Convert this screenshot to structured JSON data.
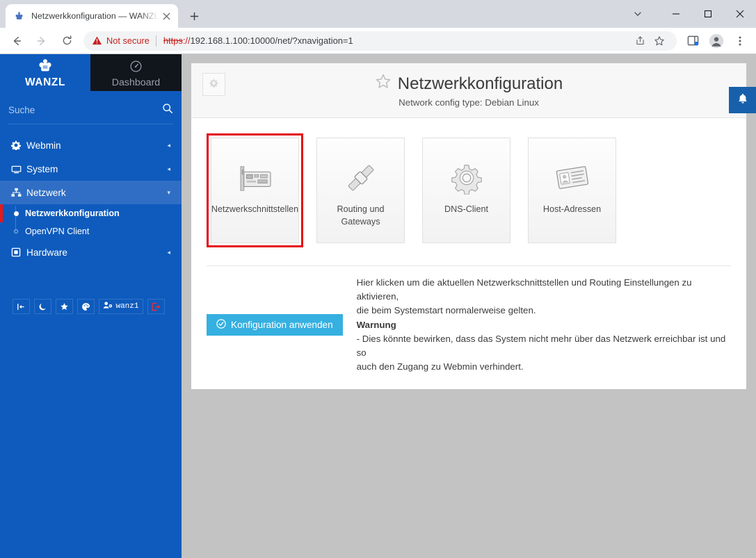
{
  "browser": {
    "tab": {
      "title": "Netzwerkkonfiguration — WANZL",
      "favicon": "wanzl-logo-icon",
      "close": "close-tab-icon"
    },
    "new_tab_label": "+",
    "window_controls": {
      "tab_search": "chevron-down-icon",
      "minimize": "minimize-icon",
      "maximize": "maximize-icon",
      "close": "close-window-icon"
    },
    "nav": {
      "back": "back-arrow-icon",
      "forward": "forward-arrow-icon",
      "reload": "reload-icon"
    },
    "omnibox": {
      "security_label": "Not secure",
      "security_icon": "warning-triangle-icon",
      "url_scheme": "https",
      "url_separator": "://",
      "url_rest": "192.168.1.100:10000/net/?xnavigation=1",
      "share_icon": "share-icon",
      "bookmark_icon": "star-outline-icon"
    },
    "toolbar_right": {
      "sidepanel_icon": "side-panel-icon",
      "profile_icon": "profile-avatar-icon",
      "menu_icon": "three-dot-menu-icon"
    }
  },
  "sidebar": {
    "brand": {
      "name": "WANZL",
      "logo": "wanzl-trolley-logo-icon"
    },
    "dashboard_tab": {
      "label": "Dashboard",
      "icon": "gauge-icon"
    },
    "search": {
      "placeholder": "Suche",
      "value": "",
      "icon": "search-icon"
    },
    "nav": [
      {
        "label": "Webmin",
        "icon": "gear-icon",
        "caret": "◂",
        "active": false
      },
      {
        "label": "System",
        "icon": "monitor-icon",
        "caret": "◂",
        "active": false
      },
      {
        "label": "Netzwerk",
        "icon": "network-icon",
        "caret": "▾",
        "active": true
      },
      {
        "label": "Hardware",
        "icon": "hardware-chip-icon",
        "caret": "◂",
        "active": false
      }
    ],
    "subnav": [
      {
        "label": "Netzwerkkonfiguration",
        "current": true
      },
      {
        "label": "OpenVPN Client",
        "current": false
      }
    ],
    "footer_buttons": [
      {
        "name": "collapse-sidebar-button",
        "icon": "collapse-left-icon",
        "label": ""
      },
      {
        "name": "dark-mode-button",
        "icon": "moon-icon",
        "label": ""
      },
      {
        "name": "favorites-button",
        "icon": "star-icon",
        "label": ""
      },
      {
        "name": "theme-button",
        "icon": "palette-icon",
        "label": ""
      },
      {
        "name": "user-button",
        "icon": "user-gear-icon",
        "label": "wanz1"
      },
      {
        "name": "logout-button",
        "icon": "logout-icon",
        "label": ""
      }
    ]
  },
  "page": {
    "settings_icon": "gear-icon",
    "favorite_icon": "star-outline-icon",
    "title": "Netzwerkkonfiguration",
    "subtitle": "Network config type: Debian Linux",
    "notification_icon": "bell-icon",
    "cards": [
      {
        "label": "Netzwerkschnittstellen",
        "icon": "network-card-icon",
        "selected": true
      },
      {
        "label": "Routing und Gateways",
        "icon": "routing-pipe-icon",
        "selected": false
      },
      {
        "label": "DNS-Client",
        "icon": "gear-cog-icon",
        "selected": false
      },
      {
        "label": "Host-Adressen",
        "icon": "address-card-icon",
        "selected": false
      }
    ],
    "apply": {
      "button_label": "Konfiguration anwenden",
      "button_icon": "check-circle-icon",
      "button_color": "#35b0e0",
      "description_line1": "Hier klicken um die aktuellen Netzwerkschnittstellen und Routing Einstellungen zu aktivieren,",
      "description_line2": "die beim Systemstart normalerweise gelten.",
      "warning_heading": "Warnung",
      "warning_line1": "- Dies könnte bewirken, dass das System nicht mehr über das Netzwerk erreichbar ist und so",
      "warning_line2": "auch den Zugang zu Webmin verhindert."
    }
  },
  "colors": {
    "sidebar_blue": "#0e5bbd",
    "accent_red": "#e30613",
    "button_cyan": "#35b0e0",
    "dashboard_dark": "#11151c"
  }
}
